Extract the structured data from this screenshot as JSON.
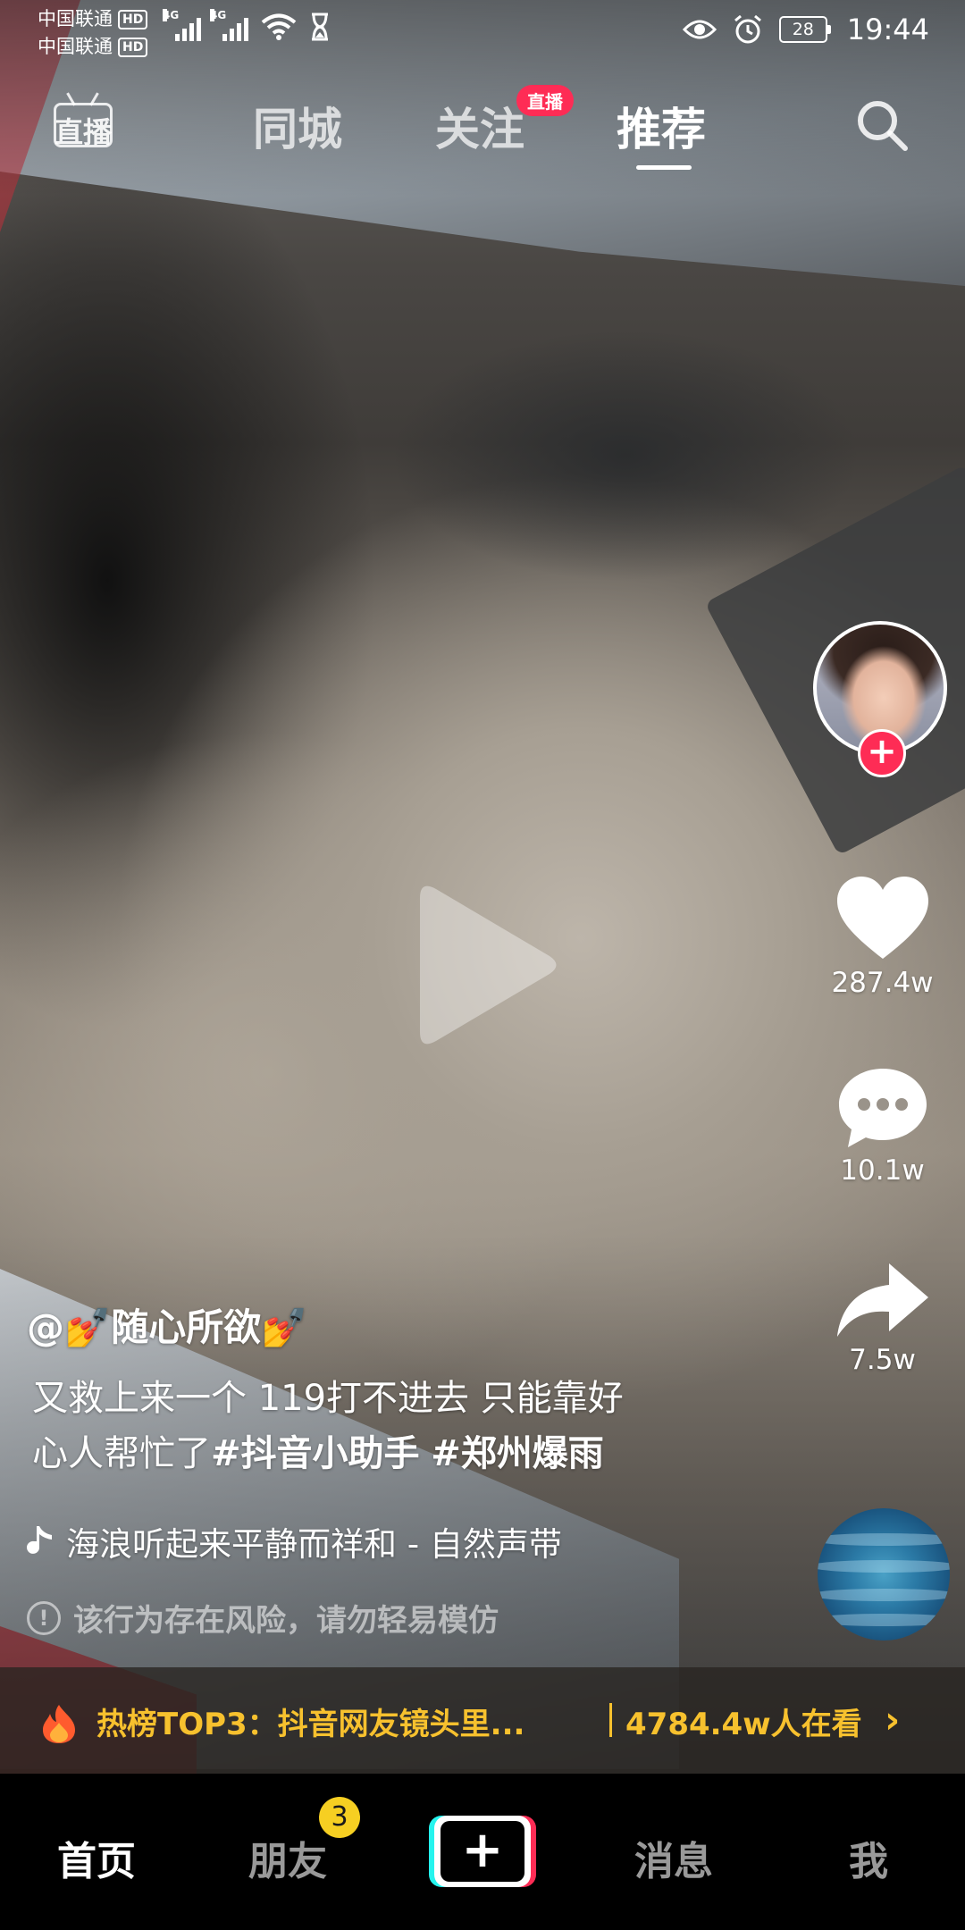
{
  "status_bar": {
    "carrier1": "中国联通",
    "carrier2": "中国联通",
    "hd": "HD",
    "network1": "4G",
    "network2": "4G",
    "battery": "28",
    "time": "19:44"
  },
  "top_nav": {
    "live_label": "直播",
    "tabs": [
      "同城",
      "关注",
      "推荐"
    ],
    "active_tab": "推荐",
    "live_badge": "直播"
  },
  "video": {
    "author": "@💅随心所欲💅",
    "author_name": "随心所欲",
    "caption_line1": "又救上来一个 119打不进去 只能靠好",
    "caption_line2_prefix": "心人帮忙了",
    "hashtags": [
      "#抖音小助手",
      "#郑州爆雨"
    ],
    "music": "海浪听起来平静而祥和 - 自然声带",
    "warning": "该行为存在风险，请勿轻易模仿"
  },
  "actions": {
    "likes": "287.4w",
    "comments": "10.1w",
    "shares": "7.5w"
  },
  "hot_bar": {
    "title": "热榜TOP3：抖音网友镜头里...",
    "viewers": "4784.4w人在看"
  },
  "bottom_nav": {
    "tabs": [
      "首页",
      "朋友",
      "消息",
      "我"
    ],
    "active_tab": "首页",
    "friends_badge": "3",
    "add_label": "+"
  },
  "colors": {
    "accent_red": "#fe2c55",
    "accent_cyan": "#25f4ee",
    "hot_yellow": "#f7c12e",
    "badge_yellow": "#f6cf22"
  }
}
